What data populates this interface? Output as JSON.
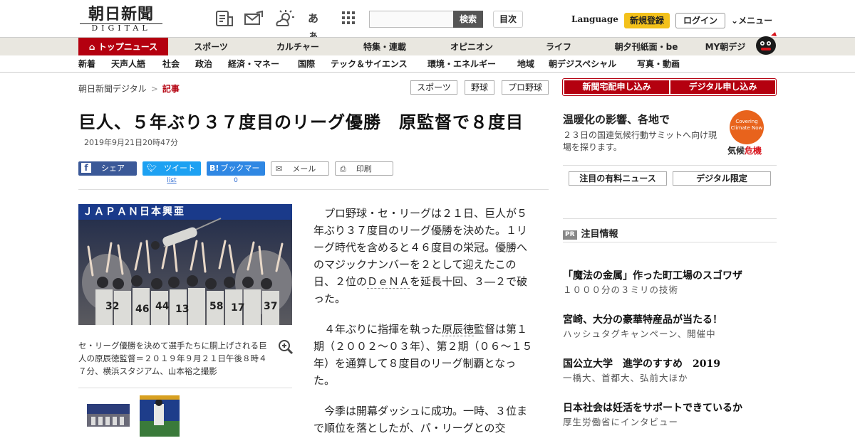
{
  "header": {
    "logo_main": "朝日新聞",
    "logo_sub": "DIGITAL",
    "search_button": "検索",
    "index_button": "目次",
    "language": "Language",
    "register": "新規登録",
    "login": "ログイン",
    "menu": "メニュー",
    "icons": [
      "news-list-icon",
      "mail-ticket-icon",
      "weather-icon",
      "font-size-icon",
      "grid-apps-icon"
    ],
    "font_icon_text": "あぁ"
  },
  "gnav": [
    "トップニュース",
    "スポーツ",
    "カルチャー",
    "特集・連載",
    "オピニオン",
    "ライフ",
    "朝夕刊紙面・be",
    "MY朝デジ"
  ],
  "subnav": [
    "新着",
    "天声人語",
    "社会",
    "政治",
    "経済・マネー",
    "国際",
    "テック＆サイエンス",
    "環境・エネルギー",
    "地域",
    "朝デジスペシャル",
    "写真・動画"
  ],
  "breadcrumb": {
    "home": "朝日新聞デジタル",
    "separator": ">",
    "current": "記事"
  },
  "tags": [
    "スポーツ",
    "野球",
    "プロ野球"
  ],
  "article": {
    "title": "巨人、５年ぶり３７度目のリーグ優勝　原監督で８度目",
    "date": "2019年9月21日20時47分",
    "share": {
      "facebook": "シェア",
      "twitter": "ツイート",
      "twitter_count": "list",
      "hatena": "ブックマーク",
      "hatena_count": "0",
      "mail": "メール",
      "print": "印刷"
    },
    "caption": "セ・リーグ優勝を決めて選手たちに胴上げされる巨人の原辰徳監督＝２０１９年９月２１日午後８時４７分、横浜スタジアム、山本裕之撮影",
    "banner_text": "ＪＡＰＡＮ日本興亜",
    "jerseys": [
      "32",
      "46",
      "44",
      "13",
      "58",
      "17",
      "37"
    ],
    "p1_a": "プロ野球・セ・リーグは２１日、巨人が５年ぶり３７度目のリーグ優勝を決めた。１リーグ時代を含めると４６度目の栄冠。優勝へのマジックナンバーを２として迎えたこの日、２位の",
    "p1_link": "ＤｅＮＡ",
    "p1_b": "を延長十回、３―２で破った。",
    "p2_a": "４年ぶりに指揮を執った",
    "p2_link": "原辰徳",
    "p2_b": "監督は第１期（２００２～０３年）、第２期（０６～１５年）を通算して８度目のリーグ制覇となった。",
    "p3": "今季は開幕ダッシュに成功。一時、３位まで順位を落としたが、パ・リーグとの交"
  },
  "sidebar": {
    "sub_home": "新聞宅配申し込み",
    "sub_digital": "デジタル申し込み",
    "climate_title": "温暖化の影響、各地で",
    "climate_desc": "２３日の国連気候行動サミットへ向け現場を探ります。",
    "climate_badge": "Covering Climate Now",
    "climate_logo_a": "気候",
    "climate_logo_b": "危機",
    "btn_paid": "注目の有料ニュース",
    "btn_digital": "デジタル限定",
    "pr_badge": "PR",
    "pr_label": "注目情報",
    "pr_items": [
      {
        "title": "「魔法の金属」作った町工場のスゴワザ",
        "sub": "１０００分の３ミリの技術"
      },
      {
        "title": "宮崎、大分の豪華特産品が当たる！",
        "sub": "ハッシュタグキャンペーン、開催中"
      },
      {
        "title": "国公立大学　進学のすすめ　2019",
        "sub": "一橋大、首都大、弘前大ほか"
      },
      {
        "title": "日本社会は妊活をサポートできているか",
        "sub": "厚生労働省にインタビュー"
      }
    ]
  },
  "colors": {
    "brand_red": "#b4000f",
    "register_yellow": "#f3c11b",
    "nav_bg": "#e9e7e0"
  }
}
